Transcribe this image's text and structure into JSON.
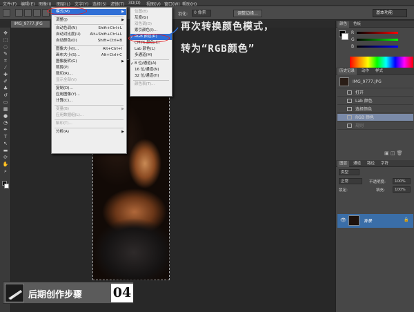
{
  "menubar": {
    "items": [
      "文件(F)",
      "编辑(E)",
      "图像(I)",
      "图层(L)",
      "文字(Y)",
      "选择(S)",
      "滤镜(T)",
      "3D(D)",
      "视图(V)",
      "窗口(W)",
      "帮助(H)"
    ]
  },
  "optbar": {
    "adjust_edge_label": "调整边缘...",
    "workspace_label": "基本功能",
    "feather_label": "羽化:",
    "feather_value": "0 像素",
    "style_label": "样式:",
    "width_label": "宽度:",
    "height_label": "高度:"
  },
  "document": {
    "tab_label": "IMG_9777.JPG"
  },
  "image_menu": {
    "items": [
      {
        "label": "模式(M)",
        "shortcut": "",
        "submenu": true,
        "highlight": true
      },
      {
        "separator": true
      },
      {
        "label": "调整(J)",
        "shortcut": "",
        "submenu": true
      },
      {
        "separator": true
      },
      {
        "label": "自动色调(N)",
        "shortcut": "Shift+Ctrl+L"
      },
      {
        "label": "自动对比度(U)",
        "shortcut": "Alt+Shift+Ctrl+L"
      },
      {
        "label": "自动颜色(O)",
        "shortcut": "Shift+Ctrl+B"
      },
      {
        "separator": true
      },
      {
        "label": "图像大小(I)...",
        "shortcut": "Alt+Ctrl+I"
      },
      {
        "label": "画布大小(S)...",
        "shortcut": "Alt+Ctrl+C"
      },
      {
        "label": "图像旋转(G)",
        "shortcut": "",
        "submenu": true
      },
      {
        "label": "裁剪(P)",
        "shortcut": ""
      },
      {
        "label": "裁切(R)...",
        "shortcut": ""
      },
      {
        "label": "显示全部(V)",
        "shortcut": "",
        "disabled": true
      },
      {
        "separator": true
      },
      {
        "label": "复制(D)...",
        "shortcut": ""
      },
      {
        "label": "应用图像(Y)...",
        "shortcut": ""
      },
      {
        "label": "计算(C)...",
        "shortcut": ""
      },
      {
        "separator": true
      },
      {
        "label": "变量(B)",
        "shortcut": "",
        "submenu": true,
        "disabled": true
      },
      {
        "label": "应用数据组(L)...",
        "shortcut": "",
        "disabled": true
      },
      {
        "separator": true
      },
      {
        "label": "陷印(T)...",
        "shortcut": "",
        "disabled": true
      },
      {
        "separator": true
      },
      {
        "label": "分析(A)",
        "shortcut": "",
        "submenu": true
      }
    ]
  },
  "mode_menu": {
    "items": [
      {
        "label": "位图(B)",
        "disabled": true
      },
      {
        "label": "灰度(G)"
      },
      {
        "label": "双色调(D)",
        "disabled": true
      },
      {
        "label": "索引颜色(I)..."
      },
      {
        "label": "RGB 颜色(R)",
        "checked": true,
        "highlight": true
      },
      {
        "label": "CMYK 颜色(C)"
      },
      {
        "label": "Lab 颜色(L)"
      },
      {
        "label": "多通道(M)"
      },
      {
        "separator": true
      },
      {
        "label": "8 位/通道(A)",
        "checked": true
      },
      {
        "label": "16 位/通道(N)"
      },
      {
        "label": "32 位/通道(H)"
      },
      {
        "separator": true
      },
      {
        "label": "颜色表(T)...",
        "disabled": true
      }
    ]
  },
  "annotation": {
    "line1": "再次转换颜色模式，",
    "line2": "转为“RGB颜色”"
  },
  "color_panel": {
    "tabs": [
      "颜色",
      "色板"
    ],
    "r_label": "R",
    "g_label": "G",
    "b_label": "B"
  },
  "history_panel": {
    "tabs": [
      "历史记录",
      "动作",
      "样式"
    ],
    "snapshot_label": "IMG_9777.JPG",
    "items": [
      {
        "label": "打开"
      },
      {
        "label": "Lab 颜色"
      },
      {
        "label": "选择颜色"
      },
      {
        "label": "RGB 颜色",
        "selected": true
      },
      {
        "label": "规则",
        "dim": true
      }
    ]
  },
  "layers_panel": {
    "tabs": [
      "图层",
      "通道",
      "路径",
      "字符"
    ],
    "kind_label": "类型",
    "blend_mode": "正常",
    "opacity_label": "不透明度:",
    "opacity_value": "100%",
    "lock_label": "锁定:",
    "fill_label": "填充:",
    "fill_value": "100%",
    "layer_name": "背景"
  },
  "badge": {
    "title": "后期创作步骤",
    "number": "04"
  },
  "colors": {
    "menu_highlight": "#2f6fd6",
    "annotation_red": "#e0202a",
    "history_selected": "#7a8aa8",
    "layer_selected": "#3a6ea8"
  }
}
